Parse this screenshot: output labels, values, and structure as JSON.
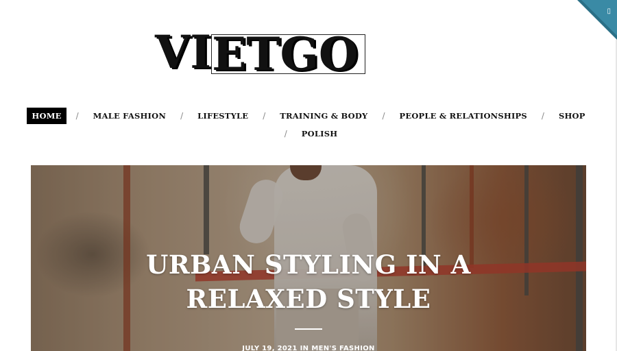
{
  "corner": {
    "icon": "search-icon",
    "glyph": "▯",
    "color": "#2a6f86"
  },
  "logo": {
    "part1": "VI",
    "part2": "ETGO"
  },
  "nav": {
    "row1": [
      {
        "label": "HOME",
        "active": true
      },
      {
        "label": "MALE FASHION"
      },
      {
        "label": "LIFESTYLE"
      },
      {
        "label": "TRAINING & BODY"
      },
      {
        "label": "PEOPLE & RELATIONSHIPS"
      },
      {
        "label": "SHOP"
      }
    ],
    "row2": [
      {
        "label": "POLISH"
      }
    ],
    "separator": "/"
  },
  "hero": {
    "title": "URBAN STYLING IN A RELAXED STYLE",
    "date": "JULY 19, 2021",
    "category_prefix": "IN",
    "category": "MEN'S FASHION"
  }
}
